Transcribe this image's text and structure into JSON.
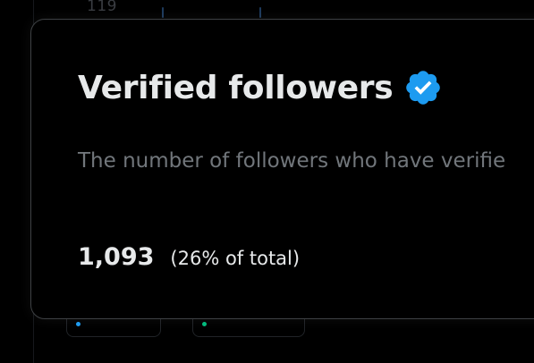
{
  "background": {
    "axis_value": "119"
  },
  "card": {
    "title": "Verified followers",
    "badge_icon": "verified-badge-icon",
    "badge_color": "#1d9bf0",
    "description": "The number of followers who have verifie",
    "stat_value": "1,093",
    "stat_share": "(26% of total)"
  },
  "colors": {
    "background": "#000000",
    "text_primary": "#e7e9ea",
    "text_secondary": "#71767b",
    "card_border": "#3e4144"
  }
}
